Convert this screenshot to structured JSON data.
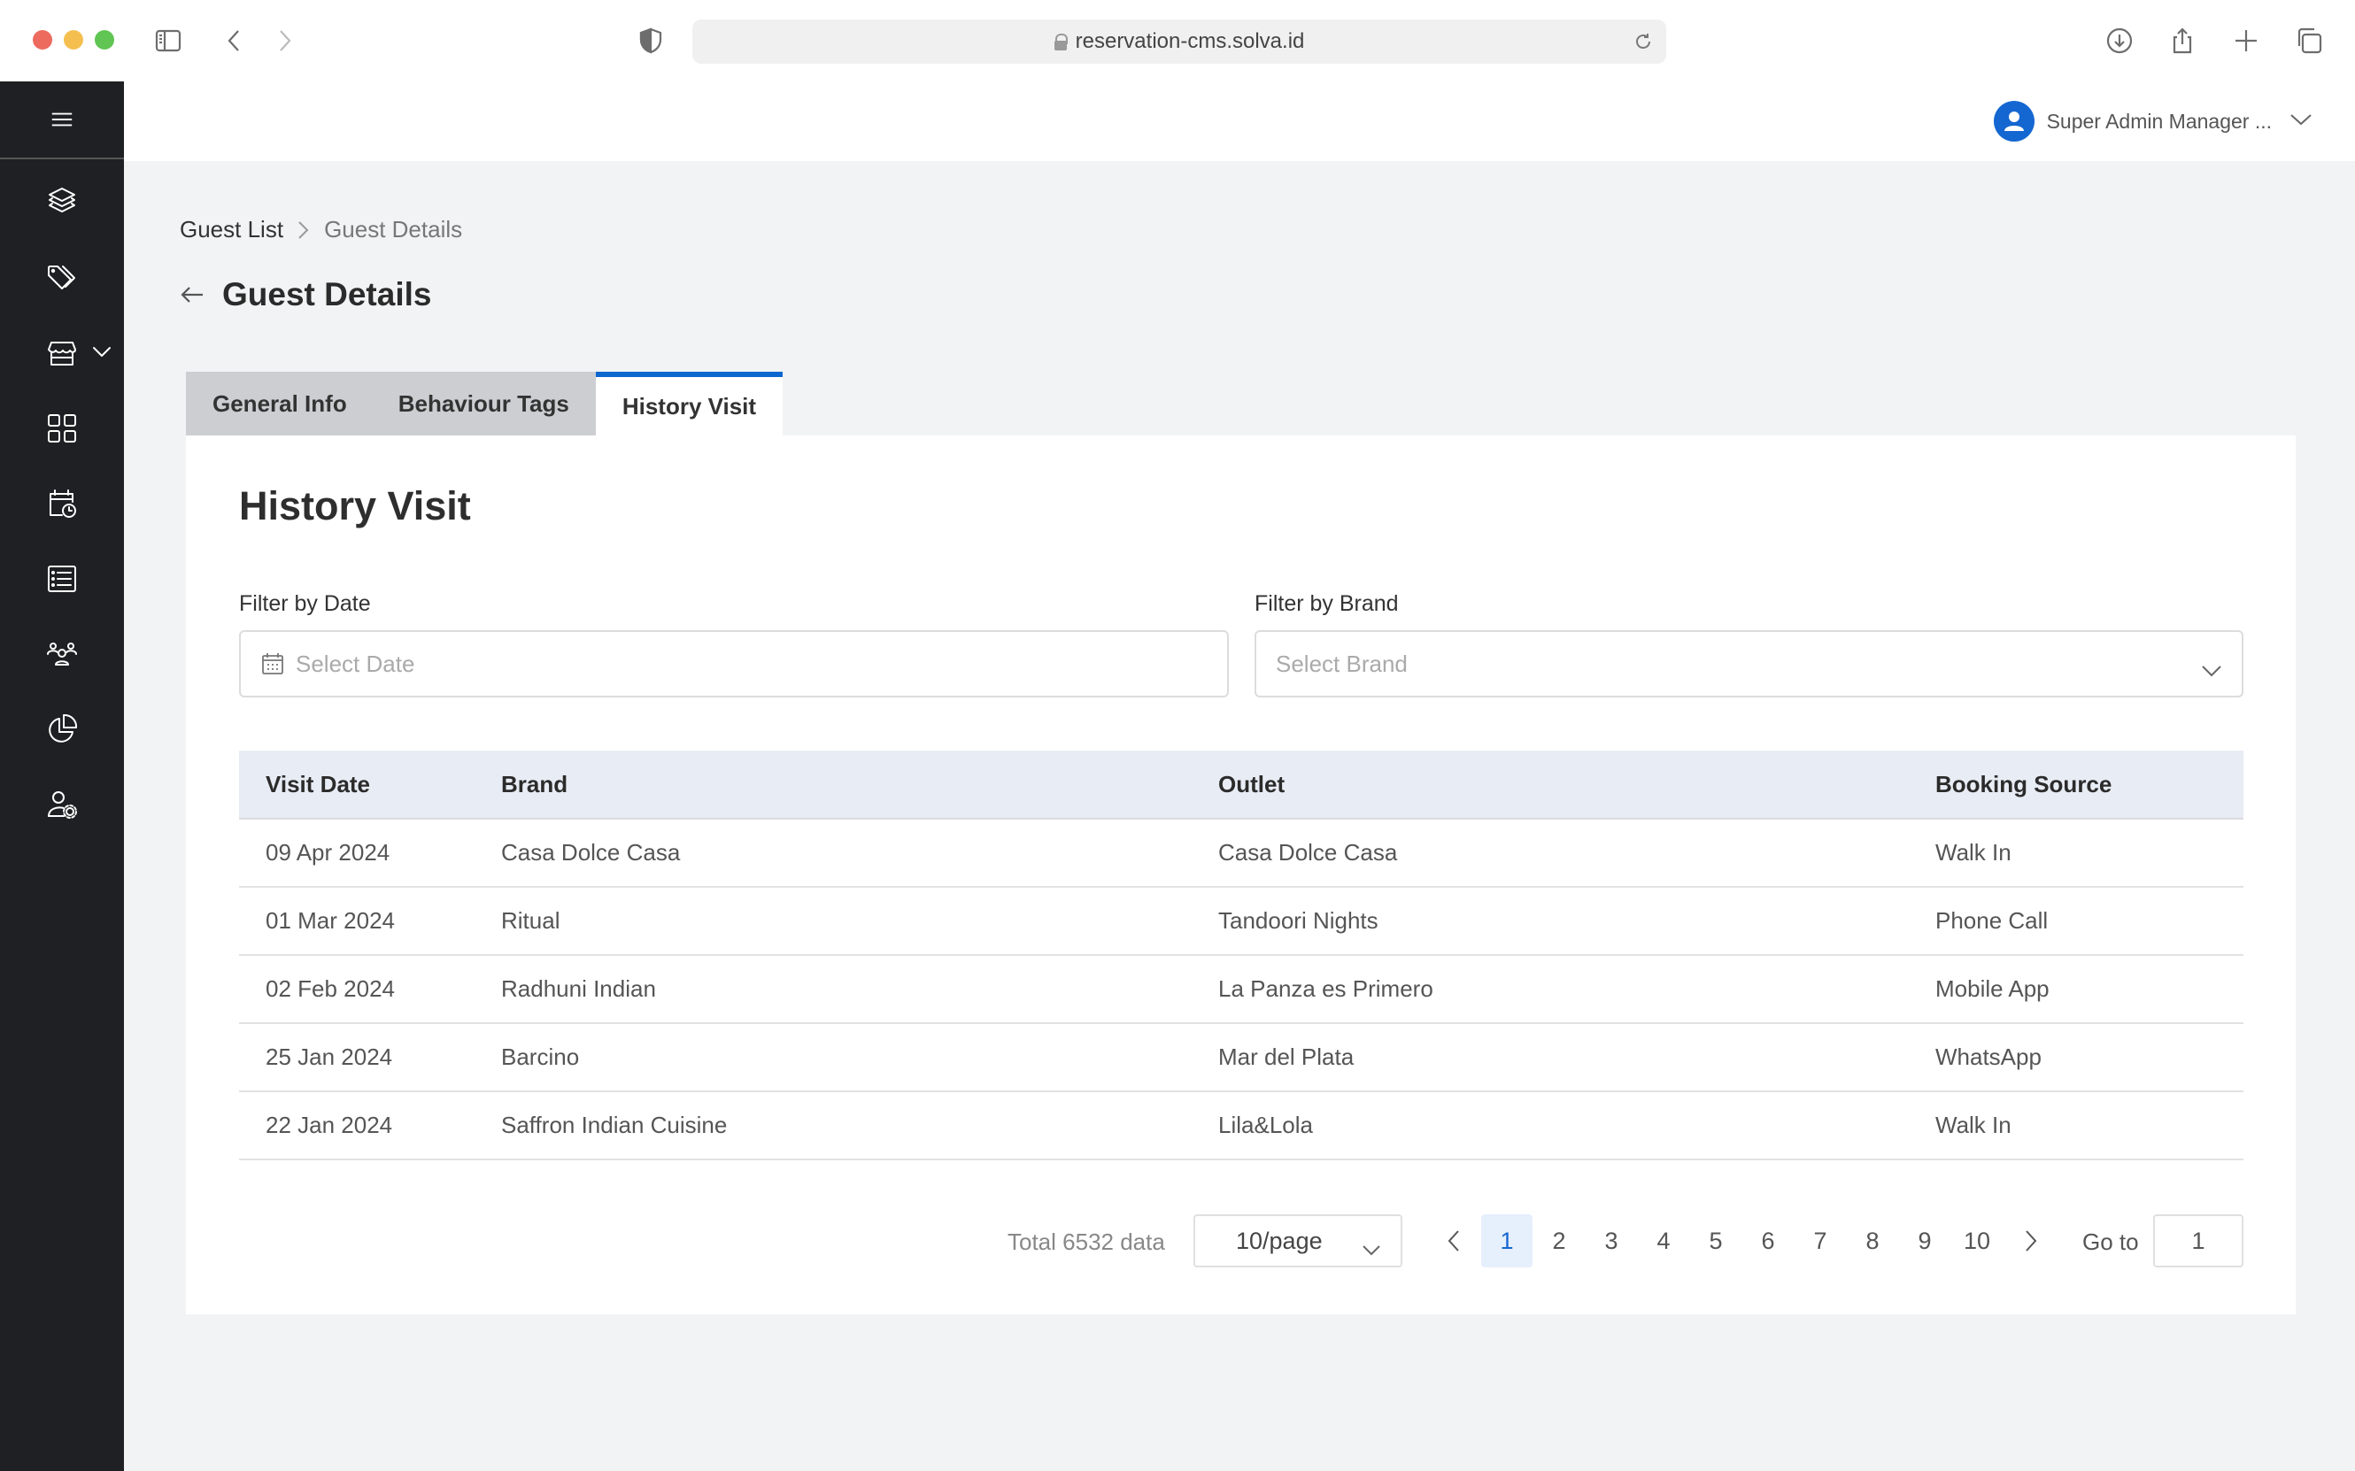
{
  "browser": {
    "url": "reservation-cms.solva.id",
    "icons": [
      "sidebar-toggle-icon",
      "back-icon",
      "forward-icon",
      "shield-icon",
      "lock-icon",
      "reload-icon",
      "download-icon",
      "share-icon",
      "new-tab-icon",
      "tabs-overview-icon"
    ]
  },
  "sidebar": {
    "items": [
      {
        "icon": "menu-icon"
      },
      {
        "icon": "layers-icon"
      },
      {
        "icon": "tags-icon"
      },
      {
        "icon": "store-icon",
        "expandable": true
      },
      {
        "icon": "grid-icon"
      },
      {
        "icon": "calendar-clock-icon"
      },
      {
        "icon": "list-icon"
      },
      {
        "icon": "users-group-icon"
      },
      {
        "icon": "pie-chart-icon"
      },
      {
        "icon": "user-settings-icon"
      }
    ]
  },
  "header": {
    "user_name": "Super Admin Manager ..."
  },
  "breadcrumb": {
    "items": [
      "Guest List",
      "Guest Details"
    ]
  },
  "page": {
    "title": "Guest Details"
  },
  "tabs": [
    {
      "label": "General Info",
      "active": false
    },
    {
      "label": "Behaviour Tags",
      "active": false
    },
    {
      "label": "History Visit",
      "active": true
    }
  ],
  "history": {
    "title": "History Visit",
    "filter_date": {
      "label": "Filter by Date",
      "placeholder": "Select Date"
    },
    "filter_brand": {
      "label": "Filter by Brand",
      "placeholder": "Select Brand"
    },
    "columns": [
      "Visit Date",
      "Brand",
      "Outlet",
      "Booking Source"
    ],
    "rows": [
      {
        "date": "09 Apr 2024",
        "brand": "Casa Dolce Casa",
        "outlet": "Casa Dolce Casa",
        "source": "Walk In"
      },
      {
        "date": "01 Mar 2024",
        "brand": "Ritual",
        "outlet": "Tandoori Nights",
        "source": "Phone Call"
      },
      {
        "date": "02 Feb 2024",
        "brand": "Radhuni Indian",
        "outlet": "La Panza es Primero",
        "source": "Mobile App"
      },
      {
        "date": "25 Jan 2024",
        "brand": "Barcino",
        "outlet": "Mar del Plata",
        "source": "WhatsApp"
      },
      {
        "date": "22 Jan 2024",
        "brand": "Saffron Indian Cuisine",
        "outlet": "Lila&Lola",
        "source": "Walk In"
      }
    ]
  },
  "pagination": {
    "total_label": "Total 6532 data",
    "page_size": "10/page",
    "pages": [
      "1",
      "2",
      "3",
      "4",
      "5",
      "6",
      "7",
      "8",
      "9",
      "10"
    ],
    "current_page": "1",
    "goto_label": "Go to",
    "goto_value": "1"
  },
  "colors": {
    "accent": "#0b66d0",
    "sidebar_bg": "#1f2023",
    "table_header_bg": "#e8ecf4",
    "active_page_bg": "#e6effc"
  }
}
